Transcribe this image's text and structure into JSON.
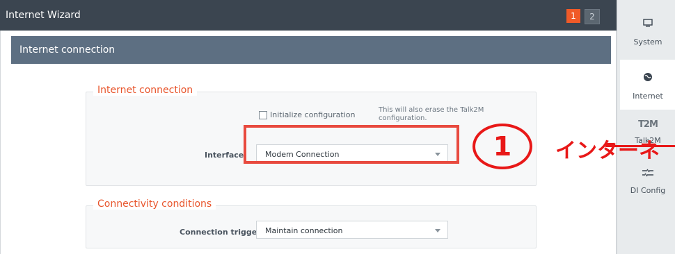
{
  "window": {
    "title": "Internet Wizard",
    "steps": [
      {
        "label": "1",
        "active": true
      },
      {
        "label": "2",
        "active": false
      }
    ]
  },
  "section": {
    "title": "Internet connection"
  },
  "internet_connection": {
    "legend": "Internet connection",
    "initialize_label": "Initialize configuration",
    "initialize_checked": false,
    "note": "This will also erase the Talk2M configuration.",
    "interface_label": "Interface:",
    "interface_value": "Modem Connection"
  },
  "connectivity_conditions": {
    "legend": "Connectivity conditions",
    "trigger_label": "Connection trigger:",
    "trigger_value": "Maintain connection"
  },
  "annotation": {
    "circle_number": "1",
    "text": "インターネ",
    "color": "#e81818"
  },
  "sidebar": {
    "items": [
      {
        "label": "System",
        "icon": "monitor-icon"
      },
      {
        "label": "Internet",
        "icon": "globe-icon",
        "active": true
      },
      {
        "label": "Talk2M",
        "icon": "t2m-logo",
        "logo_text": "T2M"
      },
      {
        "label": "DI Config",
        "icon": "sliders-icon"
      }
    ]
  },
  "colors": {
    "accent": "#f05a28",
    "header": "#3b4550",
    "section": "#5d6f82"
  }
}
